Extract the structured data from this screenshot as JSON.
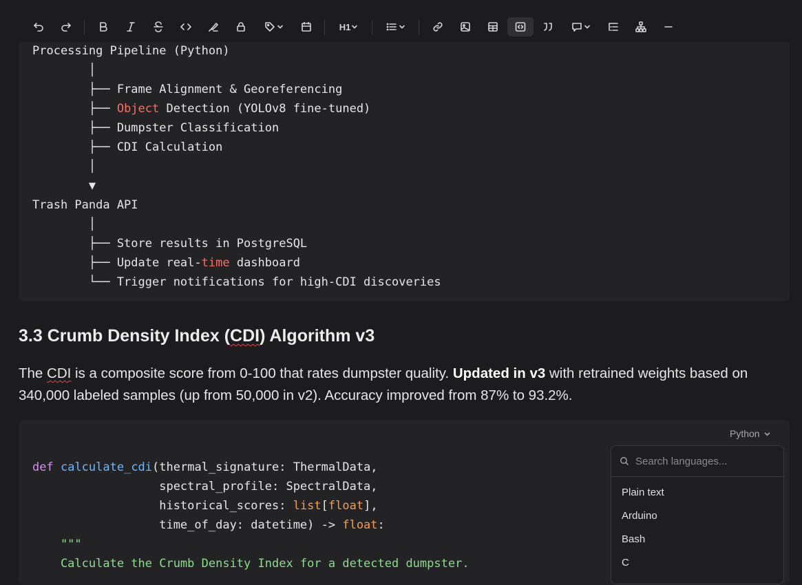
{
  "toolbar": {
    "buttons": [
      "undo-icon",
      "redo-icon",
      "bold-icon",
      "italic-icon",
      "strikethrough-icon",
      "code-icon",
      "highlight-icon",
      "lock-icon",
      "tag-icon",
      "calendar-icon",
      "heading-icon",
      "list-icon",
      "link-icon",
      "image-icon",
      "table-icon",
      "code-block-icon",
      "quote-icon",
      "comment-icon",
      "toc-icon",
      "diagram-icon",
      "divider-icon"
    ],
    "heading_label": "H1"
  },
  "pipeline_block": {
    "lines": [
      "Processing Pipeline (Python)",
      "        │",
      "        ├── Frame Alignment & Georeferencing",
      "Object",
      " Detection (YOLOv8 fine-tuned)",
      "        ├── Dumpster Classification",
      "        ├── CDI Calculation",
      "        │",
      "        ▼",
      "Trash Panda API",
      "        │",
      "        ├── Store results in PostgreSQL",
      "        ├── Update real-",
      "time",
      " dashboard",
      "        └── Trigger notifications for high-CDI discoveries"
    ],
    "prefix_branch": "        ├── "
  },
  "section": {
    "heading_pre": "3.3 Crumb Density Index (",
    "heading_abbr": "CDI",
    "heading_post": ") Algorithm v3"
  },
  "paragraph": {
    "p1": "The ",
    "abbr": "CDI",
    "p2": " is a composite score from 0-100 that rates dumpster quality. ",
    "bold": "Updated in v3",
    "p3": " with retrained weights based on 340,000 labeled samples (up from 50,000 in v2). Accuracy improved from 87% to 93.2%."
  },
  "code": {
    "language": "Python",
    "l1_def": "def",
    "l1_fn": "calculate_cdi",
    "l1_rest": "(thermal_signature: ThermalData,",
    "l2": "                  spectral_profile: SpectralData,",
    "l3_a": "                  historical_scores: ",
    "l3_list": "list",
    "l3_b": "[",
    "l3_float": "float",
    "l3_c": "],",
    "l4_a": "                  time_of_day: datetime) -> ",
    "l4_float": "float",
    "l4_b": ":",
    "l5": "    \"\"\"",
    "l6": "    Calculate the Crumb Density Index for a detected dumpster."
  },
  "language_menu": {
    "placeholder": "Search languages...",
    "items": [
      "Plain text",
      "Arduino",
      "Bash",
      "C"
    ]
  }
}
